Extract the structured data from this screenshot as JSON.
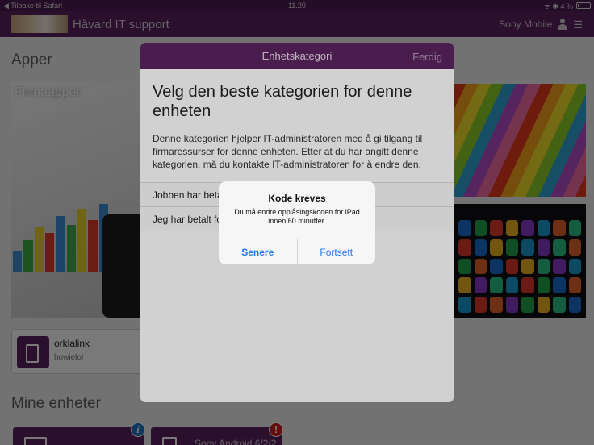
{
  "statusbar": {
    "back_label": "◀ Tilbake til Safari",
    "time": "11.20",
    "indicators": "ᯤ ✱ 4 %"
  },
  "header": {
    "title": "Håvard IT support",
    "account": "Sony Mobile",
    "menu_glyph": "☰"
  },
  "apps": {
    "title": "Apper",
    "firm_tile_label": "Firmaapper",
    "applink": {
      "name": "orklalink",
      "sub": "howielol"
    }
  },
  "devices": {
    "title": "Mine enheter",
    "card2_name": "Sony Android 6/2/2",
    "info_glyph": "i",
    "error_glyph": "!"
  },
  "sheet": {
    "header": "Enhetskategori",
    "done": "Ferdig",
    "title": "Velg den beste kategorien for denne enheten",
    "description": "Denne kategorien hjelper IT-administratoren med å gi tilgang til firmaressurser for denne enheten. Etter at du har angitt denne kategorien, må du kontakte IT-administratoren for å endre den.",
    "options": [
      "Jobben har betalt for den",
      "Jeg har betalt for den"
    ]
  },
  "alert": {
    "title": "Kode kreves",
    "message": "Du må endre opplåsingskoden for iPad innen 60 minutter.",
    "primary": "Senere",
    "secondary": "Fortsett"
  },
  "colors": {
    "brand": "#5b2460",
    "brand_dark": "#4f1d52",
    "link_blue": "#1a7bf2",
    "info": "#1f78c8",
    "error": "#d21d1d"
  }
}
